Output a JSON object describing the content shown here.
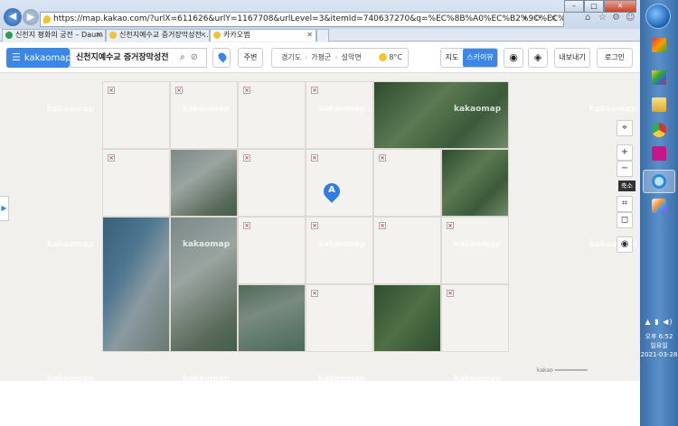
{
  "browser": {
    "url": "https://map.kakao.com/?urlX=611626&urlY=1167708&urlLevel=3&itemId=740637270&q=%EC%8B%A0%EC%B2%9C%EC%A7%80%EC%98%88%EC%88%98%EA%B5%90%",
    "url_domain": "map.kakao.com",
    "tabs": [
      {
        "label": "신천지 평화의 궁전 – Daum ...",
        "active": false
      },
      {
        "label": "신천지예수교 증거장막성전 ...",
        "active": false
      },
      {
        "label": "카카오맵",
        "active": true
      }
    ]
  },
  "header": {
    "logo": "kakaomap",
    "search_value": "신천지예수교 증거장막성전",
    "btn_nearby": "주변",
    "region": [
      "경기도",
      "가평군",
      "설악면"
    ],
    "temperature": "8°C",
    "map_mode_normal": "지도",
    "map_mode_sky": "스카이뷰",
    "btn_share": "내보내기",
    "btn_login": "로그인"
  },
  "map": {
    "watermark": "kakaomap",
    "marker_label": "A",
    "tooltip": "축소",
    "scale_text": "kakao  Slogan",
    "zoom_in": "+",
    "zoom_out": "−"
  },
  "taskbar": {
    "time": "오후 6:52",
    "weekday": "일요일",
    "date": "2021-03-28"
  }
}
